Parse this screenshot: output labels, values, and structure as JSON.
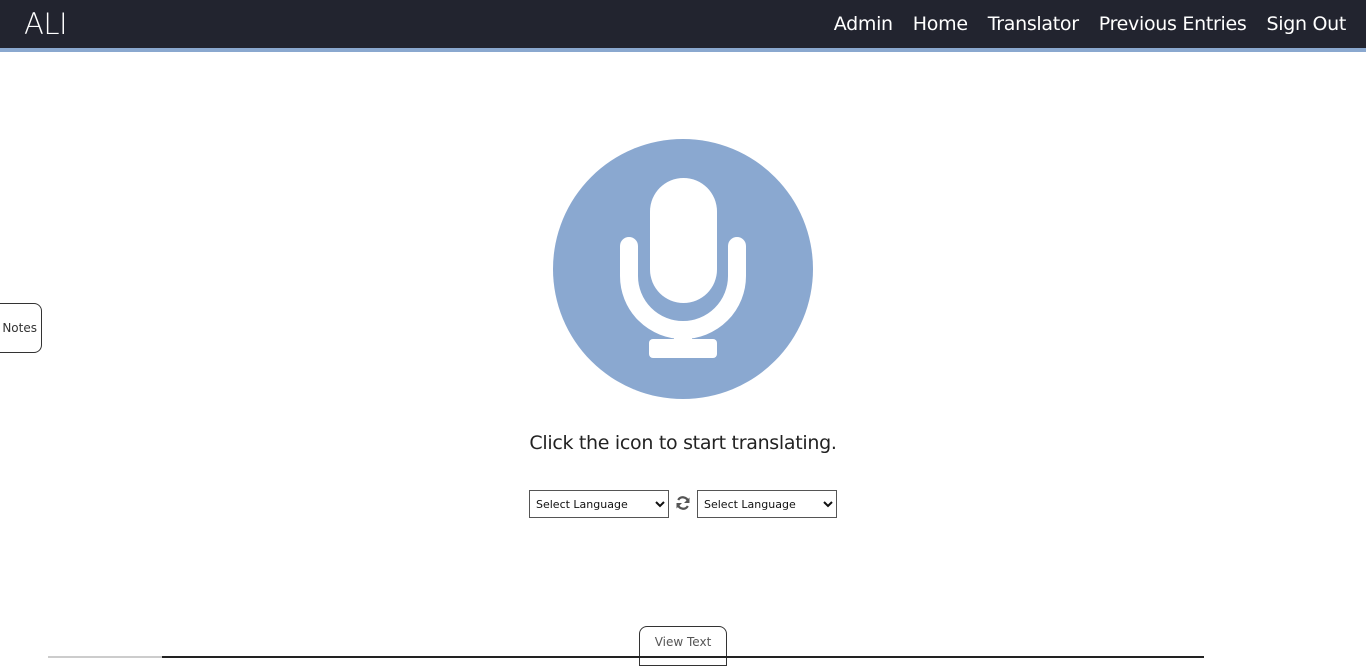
{
  "navbar": {
    "brand": "ALI",
    "links": [
      {
        "label": "Admin"
      },
      {
        "label": "Home"
      },
      {
        "label": "Translator"
      },
      {
        "label": "Previous Entries"
      },
      {
        "label": "Sign Out"
      }
    ]
  },
  "notes_tab": {
    "label": "Notes"
  },
  "mic_button": {
    "icon": "microphone-icon",
    "color": "#8aa8d0"
  },
  "prompt": "Click the icon to start translating.",
  "language_selectors": {
    "source": {
      "selected": "Select Language"
    },
    "target": {
      "selected": "Select Language"
    },
    "swap_icon": "refresh-icon"
  },
  "view_text_tab": {
    "label": "View Text"
  },
  "colors": {
    "navbar_bg": "#22242f",
    "accent": "#8aa8cf"
  }
}
